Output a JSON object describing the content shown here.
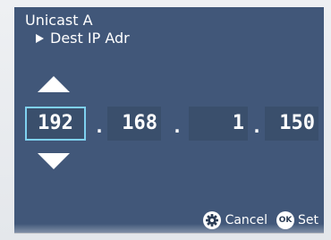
{
  "header": {
    "title": "Unicast A",
    "subtitle": "Dest IP Adr"
  },
  "ip": {
    "octets": [
      "192",
      "168",
      "1",
      "150"
    ],
    "separator": ".",
    "selected_index": 0
  },
  "footer": {
    "cancel_label": "Cancel",
    "ok_badge": "OK",
    "set_label": "Set"
  },
  "colors": {
    "panel_bg": "#415779",
    "field_bg": "#3a4f6c",
    "selection_border": "#7fd1f0",
    "text": "#ffffff"
  },
  "icons": {
    "up": "triangle-up-icon",
    "down": "triangle-down-icon",
    "cancel": "gear-icon",
    "set": "ok-icon",
    "subtitle": "play-arrow-icon"
  }
}
